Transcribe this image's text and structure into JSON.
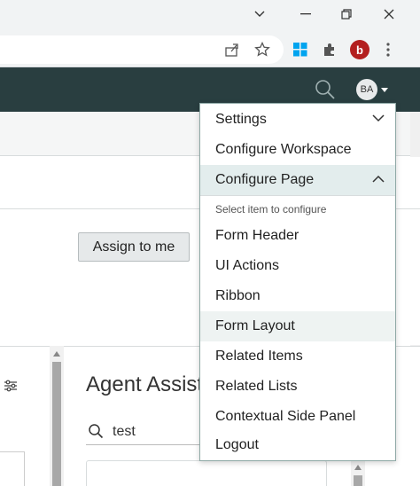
{
  "browser": {
    "profile_initial": "b"
  },
  "app": {
    "avatar_initials": "BA"
  },
  "form": {
    "assign_button": "Assign to me"
  },
  "agent_assist": {
    "title": "Agent Assist",
    "search_value": "test"
  },
  "menu": {
    "settings": "Settings",
    "configure_workspace": "Configure Workspace",
    "configure_page": "Configure Page",
    "section_label": "Select item to configure",
    "items": [
      "Form Header",
      "UI Actions",
      "Ribbon",
      "Form Layout",
      "Related Items",
      "Related Lists",
      "Contextual Side Panel"
    ],
    "logout": "Logout"
  },
  "colors": {
    "header_bg": "#293e40",
    "menu_border": "#8fa9a6",
    "active_item_bg": "#e3eded",
    "profile_red": "#b31f1f"
  }
}
